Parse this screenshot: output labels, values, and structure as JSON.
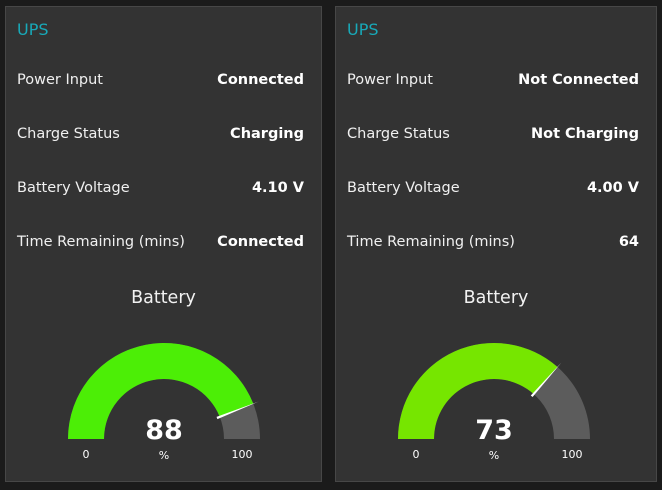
{
  "cards": [
    {
      "title": "UPS",
      "rows": [
        {
          "label": "Power Input",
          "value": "Connected"
        },
        {
          "label": "Charge Status",
          "value": "Charging"
        },
        {
          "label": "Battery Voltage",
          "value": "4.10 V"
        },
        {
          "label": "Time Remaining (mins)",
          "value": "Connected"
        }
      ],
      "gauge": {
        "title": "Battery",
        "value": 88,
        "display": "88",
        "unit": "%",
        "min_label": "0",
        "max_label": "100",
        "min": 0,
        "max": 100,
        "color": "#4cee06"
      }
    },
    {
      "title": "UPS",
      "rows": [
        {
          "label": "Power Input",
          "value": "Not Connected"
        },
        {
          "label": "Charge Status",
          "value": "Not Charging"
        },
        {
          "label": "Battery Voltage",
          "value": "4.00 V"
        },
        {
          "label": "Time Remaining (mins)",
          "value": "64"
        }
      ],
      "gauge": {
        "title": "Battery",
        "value": 73,
        "display": "73",
        "unit": "%",
        "min_label": "0",
        "max_label": "100",
        "min": 0,
        "max": 100,
        "color": "#76e600"
      }
    }
  ],
  "colors": {
    "background": "#1b1b1b",
    "card": "#333333",
    "title": "#18a9b8",
    "gauge_track": "#5c5c5c",
    "needle": "#ffffff"
  }
}
